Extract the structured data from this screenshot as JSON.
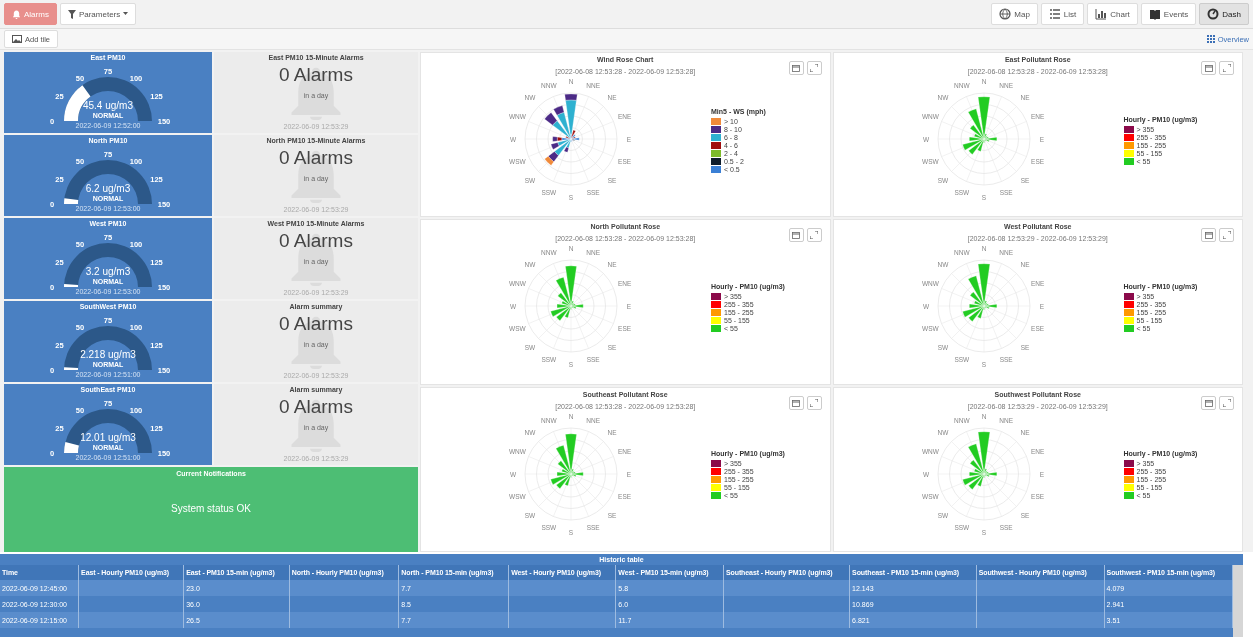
{
  "top_bar": {
    "left": [
      {
        "label": "Alarms",
        "kind": "alarm"
      },
      {
        "label": "Parameters",
        "kind": "dropdown"
      }
    ],
    "nav": [
      {
        "label": "Map",
        "selected": false
      },
      {
        "label": "List",
        "selected": false
      },
      {
        "label": "Chart",
        "selected": false
      },
      {
        "label": "Events",
        "selected": false
      },
      {
        "label": "Dash",
        "selected": true
      }
    ]
  },
  "tile_bar": {
    "add_tile": "Add tile",
    "overview": "Overview"
  },
  "gauges": [
    {
      "title": "East PM10",
      "ticks": [
        "0",
        "25",
        "50",
        "75",
        "100",
        "125",
        "150"
      ],
      "value": "45.4 ug/m3",
      "status": "NORMAL",
      "time": "2022-06-09 12:52:00"
    },
    {
      "title": "North PM10",
      "ticks": [
        "0",
        "25",
        "50",
        "75",
        "100",
        "125",
        "150"
      ],
      "value": "6.2 ug/m3",
      "status": "NORMAL",
      "time": "2022-06-09 12:53:00"
    },
    {
      "title": "West PM10",
      "ticks": [
        "0",
        "25",
        "50",
        "75",
        "100",
        "125",
        "150"
      ],
      "value": "3.2 ug/m3",
      "status": "NORMAL",
      "time": "2022-06-09 12:53:00"
    },
    {
      "title": "SouthWest PM10",
      "ticks": [
        "0",
        "25",
        "50",
        "75",
        "100",
        "125",
        "150"
      ],
      "value": "2.218 ug/m3",
      "status": "NORMAL",
      "time": "2022-06-09 12:51:00"
    },
    {
      "title": "SouthEast PM10",
      "ticks": [
        "0",
        "25",
        "50",
        "75",
        "100",
        "125",
        "150"
      ],
      "value": "12.01 ug/m3",
      "status": "NORMAL",
      "time": "2022-06-09 12:51:00"
    }
  ],
  "alarm_cards": [
    {
      "title": "East PM10 15-Minute Alarms",
      "count": "0 Alarms",
      "period": "in a day",
      "time": "2022-06-09 12:53:29"
    },
    {
      "title": "North PM10 15-Minute Alarms",
      "count": "0 Alarms",
      "period": "in a day",
      "time": "2022-06-09 12:53:29"
    },
    {
      "title": "West PM10 15-Minute Alarms",
      "count": "0 Alarms",
      "period": "in a day",
      "time": "2022-06-09 12:53:29"
    },
    {
      "title": "Alarm summary",
      "count": "0 Alarms",
      "period": "in a day",
      "time": "2022-06-09 12:53:29"
    },
    {
      "title": "Alarm summary",
      "count": "0 Alarms",
      "period": "in a day",
      "time": "2022-06-09 12:53:29"
    }
  ],
  "notifications": {
    "title": "Current Notifications",
    "message": "System status OK"
  },
  "charts": [
    {
      "kind": "wind",
      "title": "Wind Rose Chart",
      "range": "[2022-06-08 12:53:28 - 2022-06-09 12:53:28]",
      "directions": [
        "N",
        "NNW",
        "NNE",
        "NW",
        "NE",
        "WNW",
        "ENE",
        "W",
        "E",
        "WSW",
        "ESE",
        "SW",
        "SE",
        "SSW",
        "SSE",
        "S"
      ],
      "legend": {
        "title": "Min5 - WS (mph)",
        "items": [
          {
            "label": "> 10",
            "color": "#f08a3a"
          },
          {
            "label": "8 - 10",
            "color": "#4b2a86"
          },
          {
            "label": "6 - 8",
            "color": "#2eb1d0"
          },
          {
            "label": "4 - 6",
            "color": "#a00e0e"
          },
          {
            "label": "2 - 4",
            "color": "#7dbb2a"
          },
          {
            "label": "0.5 - 2",
            "color": "#0d1b2a"
          },
          {
            "label": "< 0.5",
            "color": "#3a7fd5"
          }
        ]
      }
    },
    {
      "kind": "pollutant",
      "title": "East Pollutant Rose",
      "range": "[2022-06-08 12:53:28 - 2022-06-09 12:53:28]",
      "directions": [
        "N",
        "NNW",
        "NNE",
        "NW",
        "NE",
        "WNW",
        "ENE",
        "W",
        "E",
        "WSW",
        "ESE",
        "SW",
        "SE",
        "SSW",
        "SSE",
        "S"
      ],
      "legend": {
        "title": "Hourly - PM10 (ug/m3)",
        "items": [
          {
            "label": "> 355",
            "color": "#8b0a4a"
          },
          {
            "label": "255 - 355",
            "color": "#ff0000"
          },
          {
            "label": "155 - 255",
            "color": "#ff9900"
          },
          {
            "label": "55 - 155",
            "color": "#ffff00"
          },
          {
            "label": "< 55",
            "color": "#22cc22"
          }
        ]
      }
    },
    {
      "kind": "pollutant",
      "title": "North Pollutant Rose",
      "range": "[2022-06-08 12:53:28 - 2022-06-09 12:53:28]",
      "directions": [
        "N",
        "NNW",
        "NNE",
        "NW",
        "NE",
        "WNW",
        "ENE",
        "W",
        "E",
        "WSW",
        "ESE",
        "SW",
        "SE",
        "SSW",
        "SSE",
        "S"
      ],
      "legend": {
        "title": "Hourly - PM10 (ug/m3)",
        "items": [
          {
            "label": "> 355",
            "color": "#8b0a4a"
          },
          {
            "label": "255 - 355",
            "color": "#ff0000"
          },
          {
            "label": "155 - 255",
            "color": "#ff9900"
          },
          {
            "label": "55 - 155",
            "color": "#ffff00"
          },
          {
            "label": "< 55",
            "color": "#22cc22"
          }
        ]
      }
    },
    {
      "kind": "pollutant",
      "title": "West Pollutant Rose",
      "range": "[2022-06-08 12:53:29 - 2022-06-09 12:53:29]",
      "directions": [
        "N",
        "NNW",
        "NNE",
        "NW",
        "NE",
        "WNW",
        "ENE",
        "W",
        "E",
        "WSW",
        "ESE",
        "SW",
        "SE",
        "SSW",
        "SSE",
        "S"
      ],
      "legend": {
        "title": "Hourly - PM10 (ug/m3)",
        "items": [
          {
            "label": "> 355",
            "color": "#8b0a4a"
          },
          {
            "label": "255 - 355",
            "color": "#ff0000"
          },
          {
            "label": "155 - 255",
            "color": "#ff9900"
          },
          {
            "label": "55 - 155",
            "color": "#ffff00"
          },
          {
            "label": "< 55",
            "color": "#22cc22"
          }
        ]
      }
    },
    {
      "kind": "pollutant",
      "title": "Southeast Pollutant Rose",
      "range": "[2022-06-08 12:53:28 - 2022-06-09 12:53:28]",
      "directions": [
        "N",
        "NNW",
        "NNE",
        "NW",
        "NE",
        "WNW",
        "ENE",
        "W",
        "E",
        "WSW",
        "ESE",
        "SW",
        "SE",
        "SSW",
        "SSE",
        "S"
      ],
      "legend": {
        "title": "Hourly - PM10 (ug/m3)",
        "items": [
          {
            "label": "> 355",
            "color": "#8b0a4a"
          },
          {
            "label": "255 - 355",
            "color": "#ff0000"
          },
          {
            "label": "155 - 255",
            "color": "#ff9900"
          },
          {
            "label": "55 - 155",
            "color": "#ffff00"
          },
          {
            "label": "< 55",
            "color": "#22cc22"
          }
        ]
      }
    },
    {
      "kind": "pollutant",
      "title": "Southwest Pollutant Rose",
      "range": "[2022-06-08 12:53:29 - 2022-06-09 12:53:29]",
      "directions": [
        "N",
        "NNW",
        "NNE",
        "NW",
        "NE",
        "WNW",
        "ENE",
        "W",
        "E",
        "WSW",
        "ESE",
        "SW",
        "SE",
        "SSW",
        "SSE",
        "S"
      ],
      "legend": {
        "title": "Hourly - PM10 (ug/m3)",
        "items": [
          {
            "label": "> 355",
            "color": "#8b0a4a"
          },
          {
            "label": "255 - 355",
            "color": "#ff0000"
          },
          {
            "label": "155 - 255",
            "color": "#ff9900"
          },
          {
            "label": "55 - 155",
            "color": "#ffff00"
          },
          {
            "label": "< 55",
            "color": "#22cc22"
          }
        ]
      }
    }
  ],
  "table": {
    "title": "Historic table",
    "columns": [
      "Time",
      "East - Hourly PM10 (ug/m3)",
      "East - PM10 15-min (ug/m3)",
      "North - Hourly PM10 (ug/m3)",
      "North - PM10 15-min (ug/m3)",
      "West - Hourly PM10 (ug/m3)",
      "West - PM10 15-min (ug/m3)",
      "Southeast - Hourly PM10 (ug/m3)",
      "Southeast - PM10 15-min (ug/m3)",
      "Southwest - Hourly PM10 (ug/m3)",
      "Southwest - PM10 15-min (ug/m3)"
    ],
    "rows": [
      [
        "2022-06-09 12:45:00",
        null,
        "23.0",
        null,
        "7.7",
        null,
        "5.8",
        null,
        "12.143",
        null,
        "4.079"
      ],
      [
        "2022-06-09 12:30:00",
        null,
        "36.0",
        null,
        "8.5",
        null,
        "6.0",
        null,
        "10.869",
        null,
        "2.941"
      ],
      [
        "2022-06-09 12:15:00",
        null,
        "26.5",
        null,
        "7.7",
        null,
        "11.7",
        null,
        "6.821",
        null,
        "3.51"
      ]
    ]
  }
}
